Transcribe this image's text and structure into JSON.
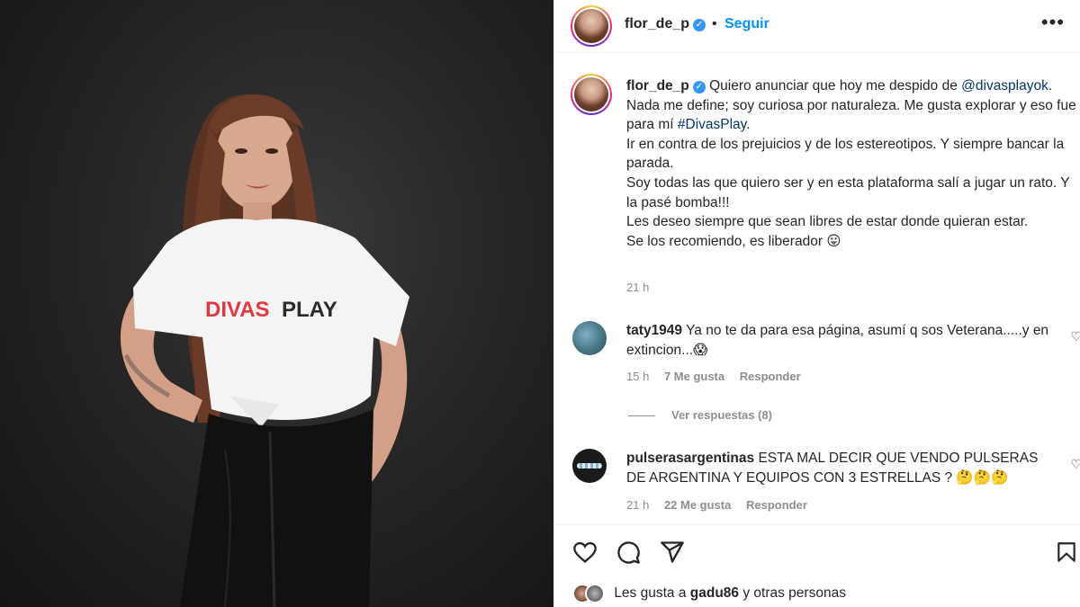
{
  "header": {
    "username": "flor_de_p",
    "separator": "•",
    "follow_label": "Seguir",
    "more_label": "•••"
  },
  "photo": {
    "shirt_text": "DIVASPLAY"
  },
  "caption": {
    "username": "flor_de_p",
    "intro": "Quiero anunciar que hoy me despido de",
    "mention": "@divasplayok",
    "mention_end": ".",
    "line2": "Nada me define; soy curiosa por naturaleza. Me gusta explorar y eso fue para mí",
    "hashtag": "#DivasPlay",
    "hashtag_end": ".",
    "line3": "Ir en contra de los prejuicios y de los estereotipos. Y siempre bancar la parada.",
    "line4": "Soy todas las que quiero ser y en esta plataforma salí a jugar un rato. Y la pasé bomba!!!",
    "line5": "Les deseo siempre que sean libres de estar donde quieran estar.",
    "line6": "Se los recomiendo, es liberador 😛",
    "time": "21 h"
  },
  "comments": [
    {
      "username": "taty1949",
      "text": "Ya no te da para esa página, asumí q sos Veterana.....y en extincion...😱",
      "time": "15 h",
      "likes": "7 Me gusta",
      "reply": "Responder",
      "view_replies": "Ver respuestas (8)"
    },
    {
      "username": "pulserasargentinas",
      "text": "ESTA MAL DECIR QUE VENDO PULSERAS DE ARGENTINA Y EQUIPOS CON 3 ESTRELLAS ? 🤔🤔🤔",
      "time": "21 h",
      "likes": "22 Me gusta",
      "reply": "Responder"
    }
  ],
  "likes_line": {
    "prefix": "Les gusta a",
    "user": "gadu86",
    "suffix": "y otras personas"
  },
  "colors": {
    "accent": "#0095f6",
    "verified": "#3897f0",
    "muted": "#8e8e8e",
    "text": "#262626",
    "shirt_red": "#e0393e"
  },
  "icons": [
    "heart-icon",
    "comment-icon",
    "share-icon",
    "bookmark-icon",
    "more-icon",
    "verified-icon"
  ]
}
